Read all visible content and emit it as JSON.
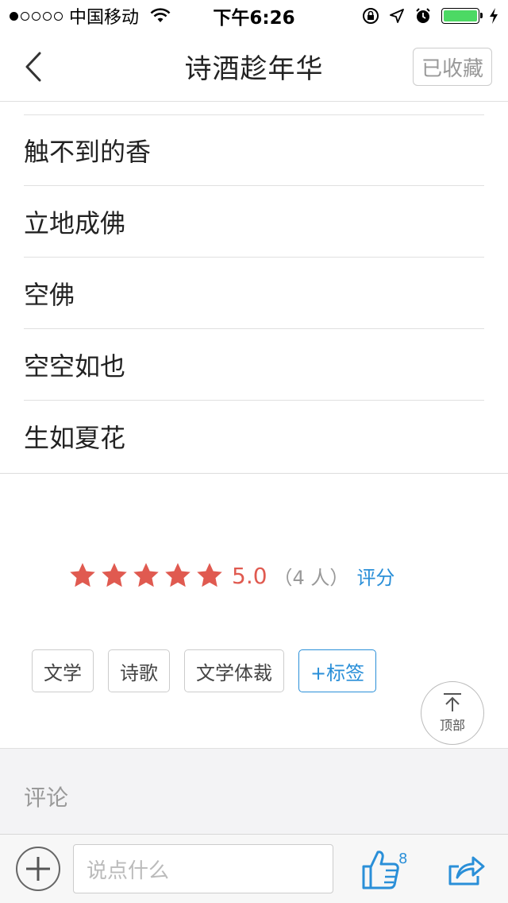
{
  "status_bar": {
    "carrier": "中国移动",
    "time": "下午6:26"
  },
  "nav": {
    "title": "诗酒趁年华",
    "collect_label": "已收藏"
  },
  "list": {
    "items": [
      "触不到的香",
      "立地成佛",
      "空佛",
      "空空如也",
      "生如夏花"
    ]
  },
  "rating": {
    "stars": 5,
    "score": "5.0",
    "count": "（4 人）",
    "link": "评分"
  },
  "tags": {
    "items": [
      "文学",
      "诗歌",
      "文学体裁"
    ],
    "add_label": "+标签"
  },
  "back_to_top": {
    "label": "顶部"
  },
  "comments": {
    "label": "评论"
  },
  "bottom_bar": {
    "input_placeholder": "说点什么",
    "like_count": "8"
  },
  "colors": {
    "accent": "#2a8fd8",
    "star": "#e05a50",
    "battery": "#4cd964"
  }
}
